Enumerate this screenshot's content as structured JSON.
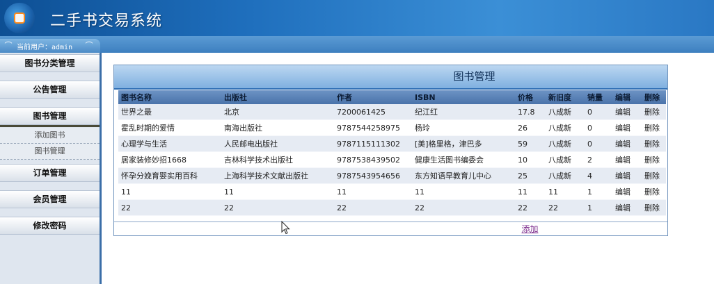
{
  "header": {
    "title": "二手书交易系统"
  },
  "userbar": {
    "label": "当前用户：admin"
  },
  "sidebar": {
    "items": [
      {
        "label": "图书分类管理"
      },
      {
        "label": "公告管理"
      },
      {
        "label": "图书管理"
      },
      {
        "label": "订单管理"
      },
      {
        "label": "会员管理"
      },
      {
        "label": "修改密码"
      }
    ],
    "subitems": [
      {
        "label": "添加图书"
      },
      {
        "label": "图书管理"
      }
    ]
  },
  "panel": {
    "title": "图书管理",
    "columns": [
      "图书名称",
      "出版社",
      "作者",
      "ISBN",
      "价格",
      "新旧度",
      "销量",
      "编辑",
      "删除"
    ],
    "rows": [
      {
        "name": "世界之最",
        "publisher": "北京",
        "author": "7200061425",
        "isbn": "纪江红",
        "price": "17.8",
        "condition": "八成新",
        "sales": "0",
        "edit": "编辑",
        "delete": "删除"
      },
      {
        "name": "霍乱时期的爱情",
        "publisher": "南海出版社",
        "author": "9787544258975",
        "isbn": "杨玲",
        "price": "26",
        "condition": "八成新",
        "sales": "0",
        "edit": "编辑",
        "delete": "删除"
      },
      {
        "name": "心理学与生活",
        "publisher": "人民邮电出版社",
        "author": "9787115111302",
        "isbn": "[美]格里格，津巴多",
        "price": "59",
        "condition": "八成新",
        "sales": "0",
        "edit": "编辑",
        "delete": "删除"
      },
      {
        "name": "居家装修妙招1668",
        "publisher": "吉林科学技术出版社",
        "author": "9787538439502",
        "isbn": "健康生活图书编委会",
        "price": "10",
        "condition": "八成新",
        "sales": "2",
        "edit": "编辑",
        "delete": "删除"
      },
      {
        "name": "怀孕分娩育婴实用百科",
        "publisher": "上海科学技术文献出版社",
        "author": "9787543954656",
        "isbn": "东方知语早教育儿中心",
        "price": "25",
        "condition": "八成新",
        "sales": "4",
        "edit": "编辑",
        "delete": "删除"
      },
      {
        "name": "11",
        "publisher": "11",
        "author": "11",
        "isbn": "11",
        "price": "11",
        "condition": "11",
        "sales": "1",
        "edit": "编辑",
        "delete": "删除"
      },
      {
        "name": "22",
        "publisher": "22",
        "author": "22",
        "isbn": "22",
        "price": "22",
        "condition": "22",
        "sales": "1",
        "edit": "编辑",
        "delete": "删除"
      }
    ],
    "add_label": "添加"
  }
}
